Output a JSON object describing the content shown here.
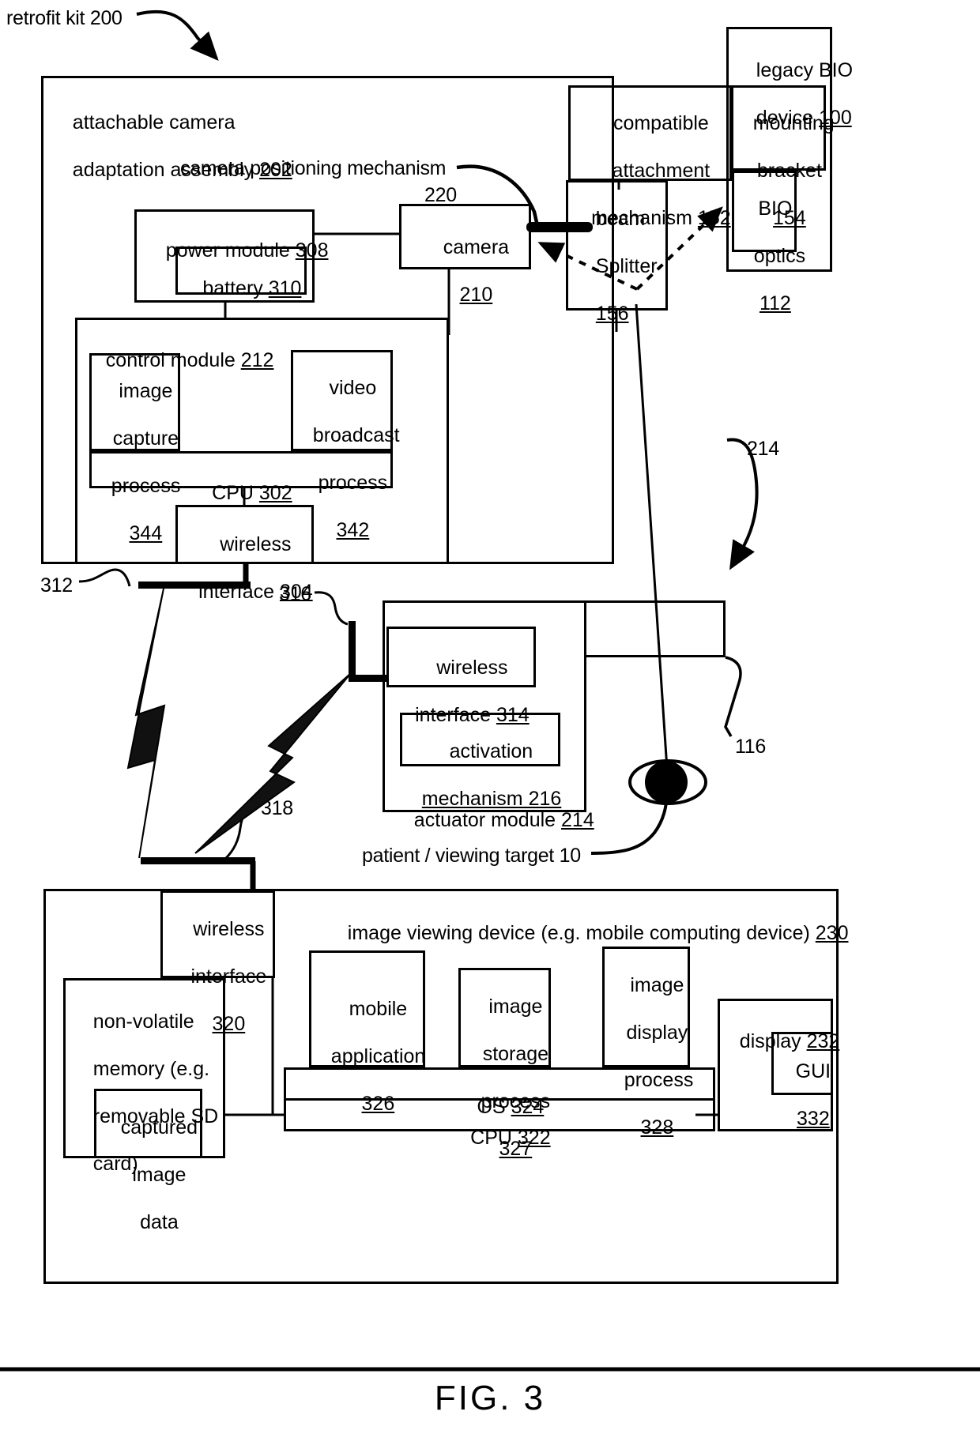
{
  "figure": {
    "caption": "FIG. 3",
    "callouts": {
      "retrofit_kit": "retrofit kit 200",
      "camera_positioning_mechanism": "camera positioning mechanism",
      "camera_positioning_mechanism_ref": "220",
      "patient_viewing_target": "patient / viewing target 10",
      "ref_312": "312",
      "ref_316": "316",
      "ref_318": "318",
      "ref_214": "214",
      "ref_116": "116"
    }
  },
  "blocks": {
    "attachable_camera_adaptation_assembly": {
      "line1": "attachable camera",
      "line2": "adaptation assembly ",
      "ref": "202"
    },
    "power_module": {
      "label": "power module ",
      "ref": "308"
    },
    "battery": {
      "label": "battery ",
      "ref": "310"
    },
    "camera": {
      "label": "camera",
      "ref": "210"
    },
    "control_module": {
      "label": "control module ",
      "ref": "212"
    },
    "image_capture_process": {
      "line1": "image",
      "line2": "capture",
      "line3": "process",
      "ref": "344"
    },
    "video_broadcast_process": {
      "line1": "video",
      "line2": "broadcast",
      "line3": "process",
      "ref": "342"
    },
    "cpu_302": {
      "label": "CPU ",
      "ref": "302"
    },
    "wireless_interface_304": {
      "line1": "wireless",
      "line2": "interface ",
      "ref": "304"
    },
    "compatible_attachment_mechanism": {
      "line1": "compatible",
      "line2": "attachment",
      "line3": "mechanism ",
      "ref": "152"
    },
    "beam_splitter": {
      "line1": "beam",
      "line2": "Splitter",
      "ref": "156"
    },
    "legacy_bio_device": {
      "line1": "legacy BIO",
      "line2": "device ",
      "ref": "100"
    },
    "mounting_bracket": {
      "line1": "mounting",
      "line2": "bracket",
      "ref": "154"
    },
    "bio_optics": {
      "line1": "BIO",
      "line2": "optics",
      "ref": "112"
    },
    "actuator_module": {
      "label": "actuator module ",
      "ref": "214"
    },
    "wireless_interface_314": {
      "line1": "wireless",
      "line2": "interface ",
      "ref": "314"
    },
    "activation_mechanism": {
      "line1": "activation",
      "line2": "mechanism 216"
    },
    "image_viewing_device": {
      "label": "image viewing device (e.g. mobile computing device) ",
      "ref": "230"
    },
    "wireless_interface_320": {
      "line1": "wireless",
      "line2": "interface",
      "ref": "320"
    },
    "non_volatile_memory": {
      "line1": "non-volatile",
      "line2": "memory (e.g.",
      "line3": "removable SD",
      "line4": "card)"
    },
    "captured_image_data": {
      "line1": "captured",
      "line2": "image",
      "line3": "data"
    },
    "mobile_application": {
      "line1": "mobile",
      "line2": "application",
      "ref": "326"
    },
    "image_storage_process": {
      "line1": "image",
      "line2": "storage",
      "line3": "process",
      "ref": "327"
    },
    "image_display_process": {
      "line1": "image",
      "line2": "display",
      "line3": "process",
      "ref": "328"
    },
    "os": {
      "label": "OS ",
      "ref": "324"
    },
    "cpu_322": {
      "label": "CPU ",
      "ref": "322"
    },
    "display": {
      "label": "display ",
      "ref": "232"
    },
    "gui": {
      "label": "GUI",
      "ref": "332"
    }
  },
  "colors": {
    "stroke": "#000000",
    "background": "#ffffff"
  }
}
